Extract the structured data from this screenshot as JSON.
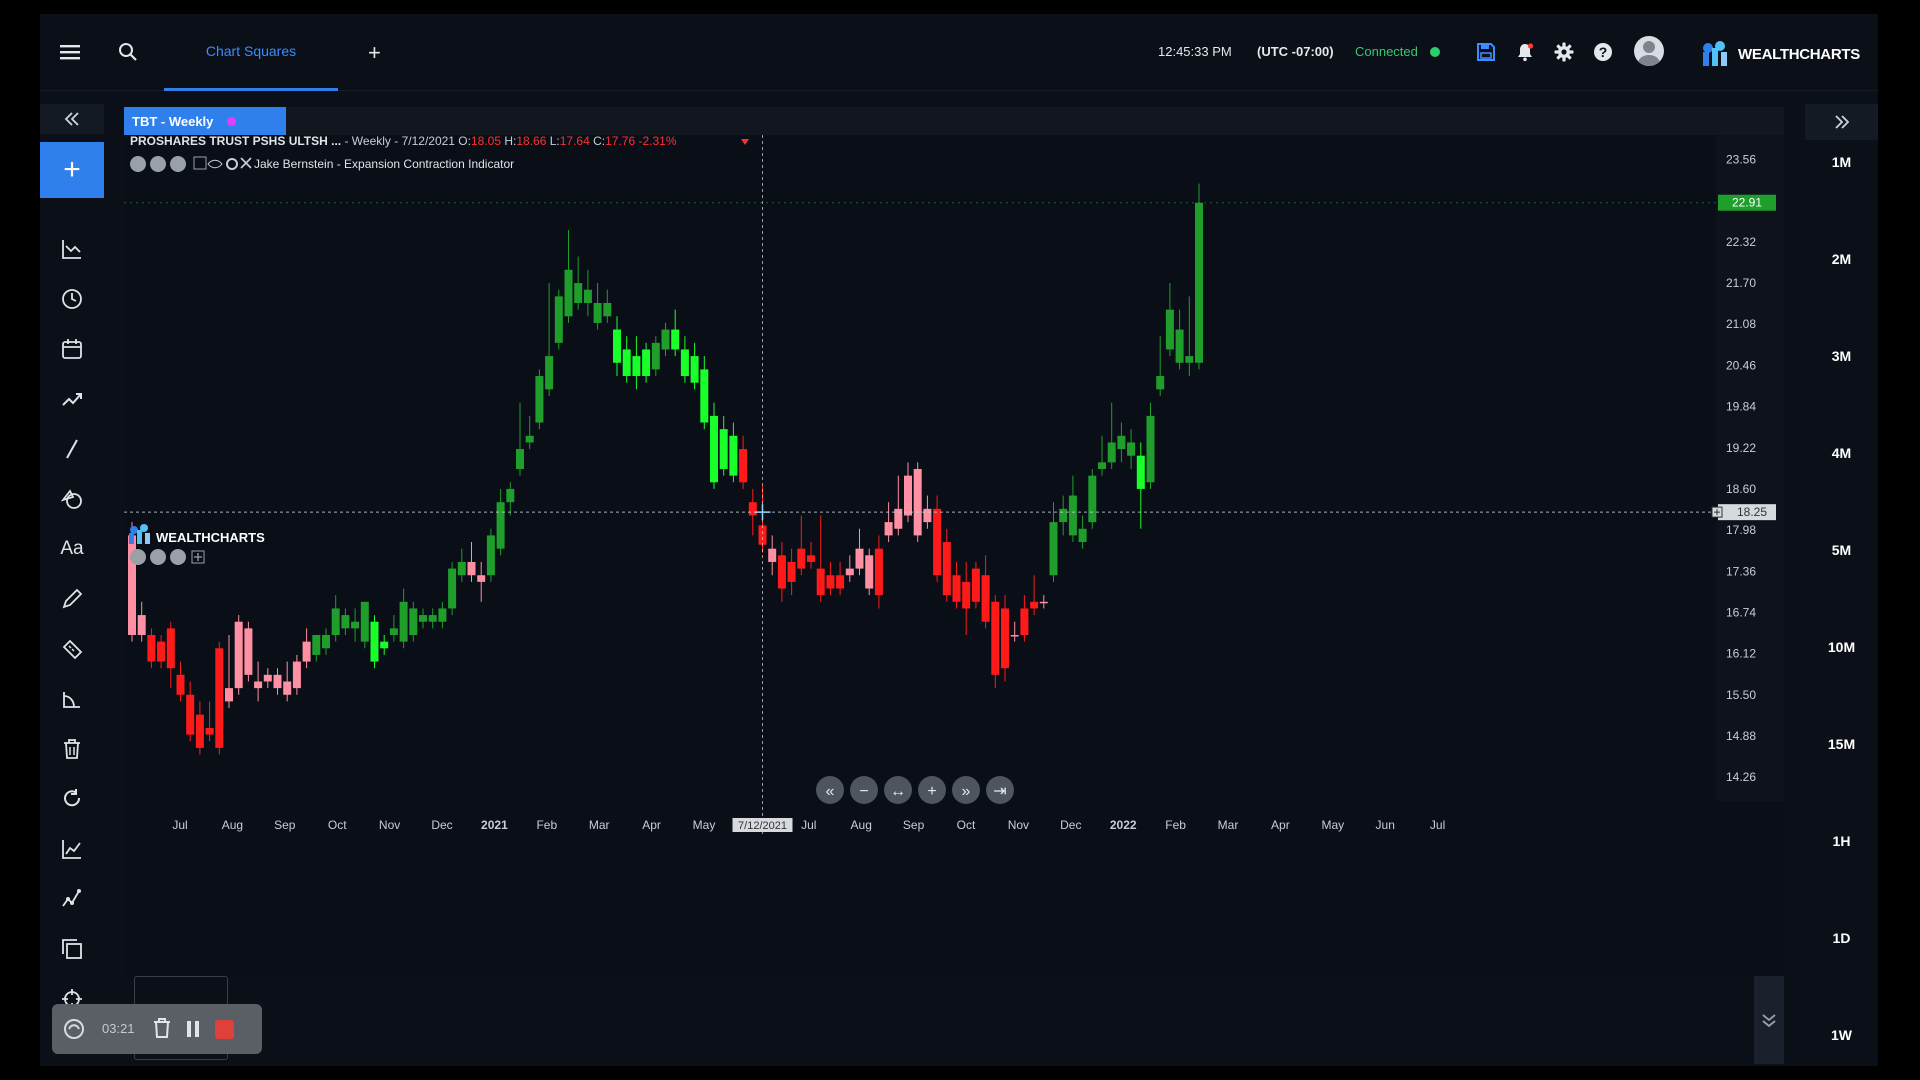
{
  "topbar": {
    "tab_label": "Chart Squares",
    "time": "12:45:33 PM",
    "timezone": "(UTC -07:00)",
    "connection_status": "Connected",
    "brand": "WEALTHCHARTS"
  },
  "chart_tab": {
    "label": "TBT - Weekly",
    "dot_color": "#e040fb"
  },
  "ohlc": {
    "symbol": "PROSHARES TRUST PSHS ULTSH ...",
    "info": " - Weekly - 7/12/2021 O:",
    "open": "18.05",
    "h_label": " H:",
    "high": "18.66",
    "l_label": " L:",
    "low": "17.64",
    "c_label": " C:",
    "close": "17.76",
    "change": "-2.31%"
  },
  "indicator": {
    "name": "Jake Bernstein - Expansion Contraction Indicator"
  },
  "watermark": "WEALTHCHARTS",
  "price_axis": [
    "23.56",
    "22.32",
    "21.70",
    "21.08",
    "20.46",
    "19.84",
    "19.22",
    "18.60",
    "17.98",
    "17.36",
    "16.74",
    "16.12",
    "15.50",
    "14.88",
    "14.26"
  ],
  "last_price": "22.91",
  "crosshair_price": "18.25",
  "crosshair_date": "7/12/2021",
  "time_axis": [
    {
      "label": "Jul",
      "bold": false
    },
    {
      "label": "Aug",
      "bold": false
    },
    {
      "label": "Sep",
      "bold": false
    },
    {
      "label": "Oct",
      "bold": false
    },
    {
      "label": "Nov",
      "bold": false
    },
    {
      "label": "Dec",
      "bold": false
    },
    {
      "label": "2021",
      "bold": true
    },
    {
      "label": "Feb",
      "bold": false
    },
    {
      "label": "Mar",
      "bold": false
    },
    {
      "label": "Apr",
      "bold": false
    },
    {
      "label": "May",
      "bold": false
    },
    {
      "label": "Jun",
      "bold": false
    },
    {
      "label": "Jul",
      "bold": false
    },
    {
      "label": "Aug",
      "bold": false
    },
    {
      "label": "Sep",
      "bold": false
    },
    {
      "label": "Oct",
      "bold": false
    },
    {
      "label": "Nov",
      "bold": false
    },
    {
      "label": "Dec",
      "bold": false
    },
    {
      "label": "2022",
      "bold": true
    },
    {
      "label": "Feb",
      "bold": false
    },
    {
      "label": "Mar",
      "bold": false
    },
    {
      "label": "Apr",
      "bold": false
    },
    {
      "label": "May",
      "bold": false
    },
    {
      "label": "Jun",
      "bold": false
    },
    {
      "label": "Jul",
      "bold": false
    }
  ],
  "timeframes": [
    "1M",
    "2M",
    "3M",
    "4M",
    "5M",
    "10M",
    "15M",
    "1H",
    "1D",
    "1W"
  ],
  "recorder": {
    "time": "03:21"
  },
  "colors": {
    "bright_green": "#19ff29",
    "dark_green": "#1f9e2c",
    "bright_red": "#ff1a1a",
    "pink": "#ff8fa3",
    "accent": "#2f80ed"
  },
  "chart_data": {
    "type": "candlestick",
    "interval": "weekly",
    "ylim": [
      13.9,
      23.9
    ],
    "candles": [
      {
        "o": 17.9,
        "h": 18.1,
        "c": 16.4,
        "l": 16.3,
        "s": "pink"
      },
      {
        "o": 16.7,
        "h": 16.9,
        "c": 16.4,
        "l": 16.3,
        "s": "pink"
      },
      {
        "o": 16.4,
        "h": 16.5,
        "c": 16.0,
        "l": 15.9,
        "s": "red"
      },
      {
        "o": 16.3,
        "h": 16.4,
        "c": 16.0,
        "l": 15.9,
        "s": "red"
      },
      {
        "o": 16.5,
        "h": 16.6,
        "c": 15.9,
        "l": 15.6,
        "s": "red"
      },
      {
        "o": 15.8,
        "h": 16.0,
        "c": 15.5,
        "l": 15.4,
        "s": "red"
      },
      {
        "o": 15.5,
        "h": 15.7,
        "c": 14.9,
        "l": 14.8,
        "s": "red"
      },
      {
        "o": 15.2,
        "h": 15.4,
        "c": 14.7,
        "l": 14.6,
        "s": "red"
      },
      {
        "o": 15.0,
        "h": 15.4,
        "c": 14.9,
        "l": 14.8,
        "s": "red"
      },
      {
        "o": 16.2,
        "h": 16.3,
        "c": 14.7,
        "l": 14.6,
        "s": "red"
      },
      {
        "o": 15.6,
        "h": 16.4,
        "c": 15.4,
        "l": 15.3,
        "s": "pink"
      },
      {
        "o": 16.6,
        "h": 16.7,
        "c": 15.6,
        "l": 15.5,
        "s": "pink"
      },
      {
        "o": 16.5,
        "h": 16.6,
        "c": 15.8,
        "l": 15.7,
        "s": "pink"
      },
      {
        "o": 15.7,
        "h": 16.0,
        "c": 15.6,
        "l": 15.4,
        "s": "pink"
      },
      {
        "o": 15.8,
        "h": 15.9,
        "c": 15.7,
        "l": 15.6,
        "s": "pink"
      },
      {
        "o": 15.8,
        "h": 15.9,
        "c": 15.6,
        "l": 15.5,
        "s": "pink"
      },
      {
        "o": 15.7,
        "h": 16.0,
        "c": 15.5,
        "l": 15.4,
        "s": "pink"
      },
      {
        "o": 16.0,
        "h": 16.1,
        "c": 15.6,
        "l": 15.5,
        "s": "pink"
      },
      {
        "o": 16.3,
        "h": 16.5,
        "c": 16.0,
        "l": 15.9,
        "s": "pink"
      },
      {
        "o": 16.1,
        "h": 16.4,
        "c": 16.4,
        "l": 16.0,
        "s": "dkgreen"
      },
      {
        "o": 16.2,
        "h": 16.5,
        "c": 16.4,
        "l": 16.1,
        "s": "dkgreen"
      },
      {
        "o": 16.4,
        "h": 17.0,
        "c": 16.8,
        "l": 16.3,
        "s": "dkgreen"
      },
      {
        "o": 16.5,
        "h": 16.8,
        "c": 16.7,
        "l": 16.4,
        "s": "dkgreen"
      },
      {
        "o": 16.5,
        "h": 16.8,
        "c": 16.6,
        "l": 16.3,
        "s": "dkgreen"
      },
      {
        "o": 16.3,
        "h": 16.9,
        "c": 16.9,
        "l": 16.2,
        "s": "dkgreen"
      },
      {
        "o": 16.0,
        "h": 16.7,
        "c": 16.6,
        "l": 15.9,
        "s": "green"
      },
      {
        "o": 16.2,
        "h": 16.4,
        "c": 16.3,
        "l": 16.1,
        "s": "green"
      },
      {
        "o": 16.4,
        "h": 16.7,
        "c": 16.5,
        "l": 16.3,
        "s": "dkgreen"
      },
      {
        "o": 16.3,
        "h": 17.1,
        "c": 16.9,
        "l": 16.2,
        "s": "dkgreen"
      },
      {
        "o": 16.4,
        "h": 16.9,
        "c": 16.8,
        "l": 16.3,
        "s": "dkgreen"
      },
      {
        "o": 16.6,
        "h": 16.8,
        "c": 16.7,
        "l": 16.5,
        "s": "dkgreen"
      },
      {
        "o": 16.6,
        "h": 16.8,
        "c": 16.7,
        "l": 16.5,
        "s": "dkgreen"
      },
      {
        "o": 16.6,
        "h": 16.9,
        "c": 16.8,
        "l": 16.5,
        "s": "dkgreen"
      },
      {
        "o": 16.8,
        "h": 17.5,
        "c": 17.4,
        "l": 16.7,
        "s": "dkgreen"
      },
      {
        "o": 17.3,
        "h": 17.7,
        "c": 17.5,
        "l": 17.2,
        "s": "dkgreen"
      },
      {
        "o": 17.5,
        "h": 17.8,
        "c": 17.3,
        "l": 17.2,
        "s": "pink"
      },
      {
        "o": 17.3,
        "h": 17.5,
        "c": 17.2,
        "l": 16.9,
        "s": "pink"
      },
      {
        "o": 17.3,
        "h": 18.0,
        "c": 17.9,
        "l": 17.2,
        "s": "dkgreen"
      },
      {
        "o": 17.7,
        "h": 18.6,
        "c": 18.4,
        "l": 17.6,
        "s": "dkgreen"
      },
      {
        "o": 18.4,
        "h": 18.7,
        "c": 18.6,
        "l": 18.2,
        "s": "dkgreen"
      },
      {
        "o": 18.9,
        "h": 19.9,
        "c": 19.2,
        "l": 18.8,
        "s": "dkgreen"
      },
      {
        "o": 19.3,
        "h": 19.7,
        "c": 19.4,
        "l": 19.2,
        "s": "dkgreen"
      },
      {
        "o": 19.6,
        "h": 20.4,
        "c": 20.3,
        "l": 19.5,
        "s": "dkgreen"
      },
      {
        "o": 20.1,
        "h": 21.7,
        "c": 20.6,
        "l": 20.0,
        "s": "dkgreen"
      },
      {
        "o": 20.8,
        "h": 21.6,
        "c": 21.5,
        "l": 20.7,
        "s": "dkgreen"
      },
      {
        "o": 21.2,
        "h": 22.5,
        "c": 21.9,
        "l": 21.1,
        "s": "dkgreen"
      },
      {
        "o": 21.4,
        "h": 22.1,
        "c": 21.7,
        "l": 21.3,
        "s": "dkgreen"
      },
      {
        "o": 21.4,
        "h": 21.9,
        "c": 21.6,
        "l": 21.2,
        "s": "dkgreen"
      },
      {
        "o": 21.1,
        "h": 21.7,
        "c": 21.4,
        "l": 21.0,
        "s": "dkgreen"
      },
      {
        "o": 21.2,
        "h": 21.6,
        "c": 21.4,
        "l": 21.1,
        "s": "dkgreen"
      },
      {
        "o": 21.0,
        "h": 21.2,
        "c": 20.5,
        "l": 20.3,
        "s": "green"
      },
      {
        "o": 20.7,
        "h": 20.9,
        "c": 20.3,
        "l": 20.2,
        "s": "green"
      },
      {
        "o": 20.6,
        "h": 20.9,
        "c": 20.3,
        "l": 20.1,
        "s": "green"
      },
      {
        "o": 20.7,
        "h": 20.8,
        "c": 20.3,
        "l": 20.2,
        "s": "green"
      },
      {
        "o": 20.4,
        "h": 20.9,
        "c": 20.8,
        "l": 20.3,
        "s": "dkgreen"
      },
      {
        "o": 20.7,
        "h": 21.1,
        "c": 21.0,
        "l": 20.6,
        "s": "dkgreen"
      },
      {
        "o": 21.0,
        "h": 21.3,
        "c": 20.7,
        "l": 20.6,
        "s": "green"
      },
      {
        "o": 20.7,
        "h": 20.9,
        "c": 20.3,
        "l": 20.2,
        "s": "green"
      },
      {
        "o": 20.6,
        "h": 20.8,
        "c": 20.2,
        "l": 20.1,
        "s": "green"
      },
      {
        "o": 20.4,
        "h": 20.6,
        "c": 19.6,
        "l": 19.5,
        "s": "green"
      },
      {
        "o": 19.7,
        "h": 19.9,
        "c": 18.7,
        "l": 18.6,
        "s": "green"
      },
      {
        "o": 19.5,
        "h": 19.7,
        "c": 18.9,
        "l": 18.8,
        "s": "green"
      },
      {
        "o": 19.4,
        "h": 19.6,
        "c": 18.8,
        "l": 18.7,
        "s": "green"
      },
      {
        "o": 19.2,
        "h": 19.4,
        "c": 18.7,
        "l": 18.6,
        "s": "red"
      },
      {
        "o": 18.4,
        "h": 18.6,
        "c": 18.2,
        "l": 17.9,
        "s": "red"
      },
      {
        "o": 18.05,
        "h": 18.66,
        "c": 17.76,
        "l": 17.64,
        "s": "red"
      },
      {
        "o": 17.7,
        "h": 17.9,
        "c": 17.5,
        "l": 17.3,
        "s": "pink"
      },
      {
        "o": 17.6,
        "h": 17.8,
        "c": 17.1,
        "l": 16.9,
        "s": "red"
      },
      {
        "o": 17.5,
        "h": 17.7,
        "c": 17.2,
        "l": 17.0,
        "s": "red"
      },
      {
        "o": 17.7,
        "h": 18.2,
        "c": 17.4,
        "l": 17.3,
        "s": "red"
      },
      {
        "o": 17.6,
        "h": 17.8,
        "c": 17.5,
        "l": 17.4,
        "s": "red"
      },
      {
        "o": 17.4,
        "h": 18.2,
        "c": 17.0,
        "l": 16.9,
        "s": "red"
      },
      {
        "o": 17.3,
        "h": 17.5,
        "c": 17.1,
        "l": 17.0,
        "s": "red"
      },
      {
        "o": 17.3,
        "h": 17.5,
        "c": 17.1,
        "l": 17.0,
        "s": "red"
      },
      {
        "o": 17.4,
        "h": 17.6,
        "c": 17.3,
        "l": 17.2,
        "s": "pink"
      },
      {
        "o": 17.7,
        "h": 18.0,
        "c": 17.4,
        "l": 17.3,
        "s": "pink"
      },
      {
        "o": 17.6,
        "h": 17.7,
        "c": 17.1,
        "l": 17.0,
        "s": "pink"
      },
      {
        "o": 17.7,
        "h": 17.9,
        "c": 17.0,
        "l": 16.8,
        "s": "red"
      },
      {
        "o": 18.1,
        "h": 18.4,
        "c": 17.9,
        "l": 17.8,
        "s": "pink"
      },
      {
        "o": 18.3,
        "h": 18.8,
        "c": 18.0,
        "l": 17.9,
        "s": "pink"
      },
      {
        "o": 18.8,
        "h": 19.0,
        "c": 18.2,
        "l": 18.1,
        "s": "pink"
      },
      {
        "o": 18.9,
        "h": 19.0,
        "c": 17.9,
        "l": 17.8,
        "s": "pink"
      },
      {
        "o": 18.3,
        "h": 18.5,
        "c": 18.1,
        "l": 18.0,
        "s": "pink"
      },
      {
        "o": 18.3,
        "h": 18.5,
        "c": 17.3,
        "l": 17.2,
        "s": "red"
      },
      {
        "o": 17.8,
        "h": 18.0,
        "c": 17.0,
        "l": 16.9,
        "s": "red"
      },
      {
        "o": 17.3,
        "h": 17.5,
        "c": 16.9,
        "l": 16.8,
        "s": "red"
      },
      {
        "o": 17.2,
        "h": 17.5,
        "c": 16.8,
        "l": 16.4,
        "s": "red"
      },
      {
        "o": 17.4,
        "h": 17.5,
        "c": 16.9,
        "l": 16.8,
        "s": "red"
      },
      {
        "o": 17.3,
        "h": 17.6,
        "c": 16.6,
        "l": 16.5,
        "s": "red"
      },
      {
        "o": 16.9,
        "h": 17.0,
        "c": 15.8,
        "l": 15.6,
        "s": "red"
      },
      {
        "o": 16.8,
        "h": 17.0,
        "c": 15.9,
        "l": 15.7,
        "s": "red"
      },
      {
        "o": 16.4,
        "h": 16.6,
        "c": 16.4,
        "l": 16.3,
        "s": "pink"
      },
      {
        "o": 16.8,
        "h": 17.0,
        "c": 16.4,
        "l": 16.3,
        "s": "red"
      },
      {
        "o": 16.9,
        "h": 17.3,
        "c": 16.8,
        "l": 16.7,
        "s": "red"
      },
      {
        "o": 16.9,
        "h": 17.0,
        "c": 16.9,
        "l": 16.8,
        "s": "pink"
      },
      {
        "o": 17.3,
        "h": 18.4,
        "c": 18.1,
        "l": 17.2,
        "s": "dkgreen"
      },
      {
        "o": 18.1,
        "h": 18.5,
        "c": 18.3,
        "l": 17.9,
        "s": "dkgreen"
      },
      {
        "o": 17.9,
        "h": 18.8,
        "c": 18.5,
        "l": 17.8,
        "s": "dkgreen"
      },
      {
        "o": 17.8,
        "h": 18.2,
        "c": 18.0,
        "l": 17.7,
        "s": "dkgreen"
      },
      {
        "o": 18.1,
        "h": 18.9,
        "c": 18.8,
        "l": 18.0,
        "s": "dkgreen"
      },
      {
        "o": 18.9,
        "h": 19.4,
        "c": 19.0,
        "l": 18.8,
        "s": "dkgreen"
      },
      {
        "o": 19.0,
        "h": 19.9,
        "c": 19.3,
        "l": 18.9,
        "s": "dkgreen"
      },
      {
        "o": 19.2,
        "h": 19.6,
        "c": 19.4,
        "l": 19.0,
        "s": "dkgreen"
      },
      {
        "o": 19.1,
        "h": 19.5,
        "c": 19.3,
        "l": 18.9,
        "s": "dkgreen"
      },
      {
        "o": 19.1,
        "h": 19.3,
        "c": 18.6,
        "l": 18.0,
        "s": "green"
      },
      {
        "o": 18.7,
        "h": 19.9,
        "c": 19.7,
        "l": 18.6,
        "s": "dkgreen"
      },
      {
        "o": 20.1,
        "h": 20.9,
        "c": 20.3,
        "l": 20.0,
        "s": "dkgreen"
      },
      {
        "o": 20.7,
        "h": 21.7,
        "c": 21.3,
        "l": 20.6,
        "s": "dkgreen"
      },
      {
        "o": 20.5,
        "h": 21.3,
        "c": 21.0,
        "l": 20.4,
        "s": "dkgreen"
      },
      {
        "o": 20.5,
        "h": 21.5,
        "c": 20.6,
        "l": 20.3,
        "s": "dkgreen"
      },
      {
        "o": 20.5,
        "h": 23.2,
        "c": 22.91,
        "l": 20.4,
        "s": "dkgreen"
      }
    ]
  }
}
